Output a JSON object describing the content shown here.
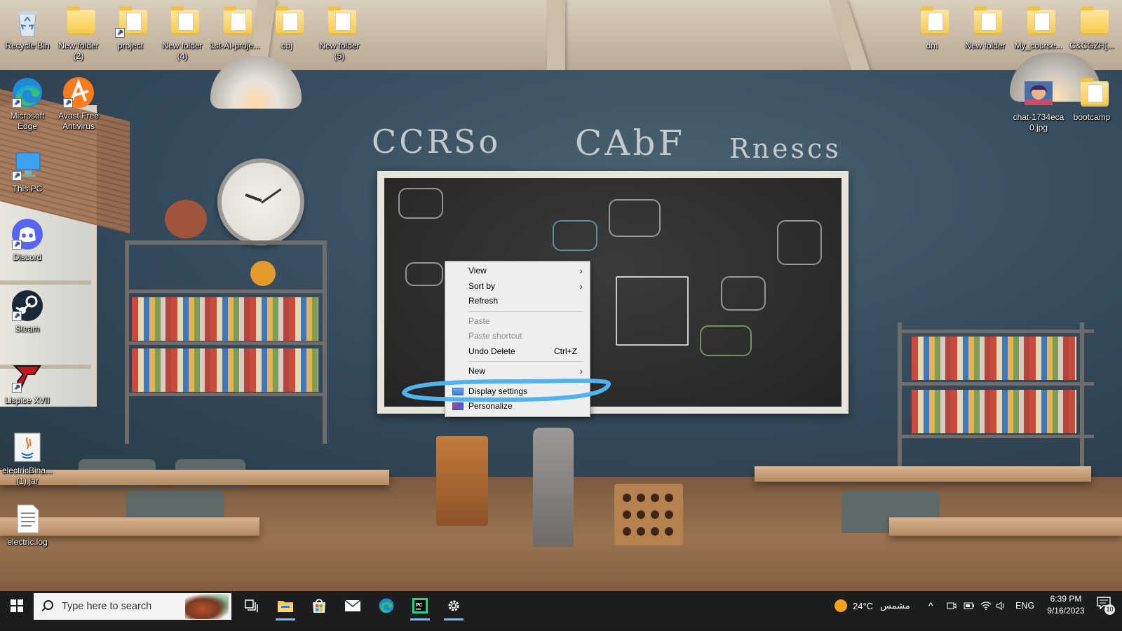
{
  "desktop": {
    "icons": [
      {
        "label": "Recycle Bin"
      },
      {
        "label": "New folder\n(2)"
      },
      {
        "label": "project"
      },
      {
        "label": "New folder\n(4)"
      },
      {
        "label": "1st-AI-proje..."
      },
      {
        "label": "obj"
      },
      {
        "label": "New folder\n(5)"
      },
      {
        "label": "Microsoft\nEdge"
      },
      {
        "label": "Avast Free\nAntivirus"
      },
      {
        "label": "This PC"
      },
      {
        "label": "Discord"
      },
      {
        "label": "Steam"
      },
      {
        "label": "Lispice XVII"
      },
      {
        "label": "electricBina...\n(1).jar"
      },
      {
        "label": "electric.log"
      },
      {
        "label": "dm"
      },
      {
        "label": "New folder"
      },
      {
        "label": "My_course..."
      },
      {
        "label": "C&CGZH[..."
      },
      {
        "label": "chat-1734eca\n0.jpg"
      },
      {
        "label": "bootcamp"
      }
    ]
  },
  "wallpaper": {
    "chalk_text_left": "CCRSo",
    "chalk_text_mid": "CAbF",
    "chalk_text_right": "Rnescs"
  },
  "context_menu": {
    "items": [
      {
        "label": "View",
        "submenu": true
      },
      {
        "label": "Sort by",
        "submenu": true
      },
      {
        "label": "Refresh"
      },
      {
        "label": "Paste",
        "disabled": true
      },
      {
        "label": "Paste shortcut",
        "disabled": true
      },
      {
        "label": "Undo Delete",
        "shortcut": "Ctrl+Z"
      },
      {
        "label": "New",
        "submenu": true
      },
      {
        "label": "Display settings",
        "icon": "display-icon",
        "highlighted": true
      },
      {
        "label": "Personalize",
        "icon": "personalize-icon"
      }
    ],
    "annotation_color": "#4fb3ef"
  },
  "taskbar": {
    "search_placeholder": "Type here to search",
    "weather": {
      "temp": "24°C",
      "condition": "مشمس"
    },
    "language": "ENG",
    "time": "6:39 PM",
    "date": "9/16/2023",
    "notification_count": "10",
    "pinned": [
      "task-view-icon",
      "file-explorer-icon",
      "microsoft-store-icon",
      "mail-icon",
      "edge-icon",
      "pycharm-icon",
      "settings-icon"
    ],
    "accent": "#8ab4f8"
  }
}
